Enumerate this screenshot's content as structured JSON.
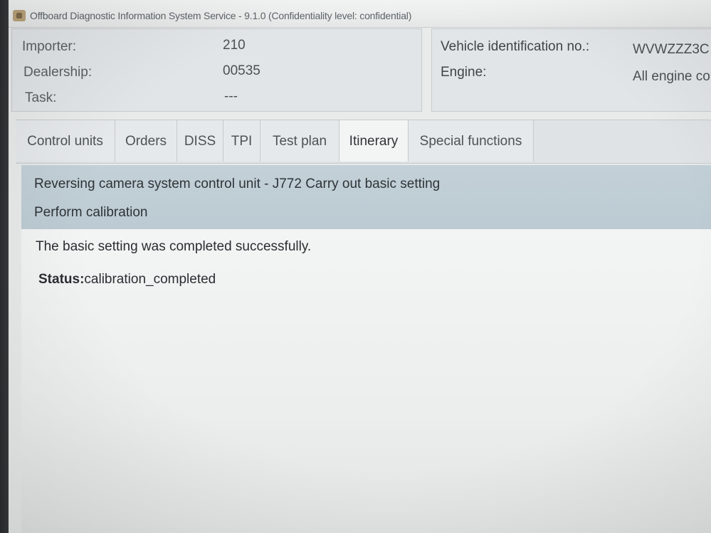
{
  "window": {
    "title": "Offboard Diagnostic Information System Service - 9.1.0 (Confidentiality level: confidential)"
  },
  "header": {
    "importer_label": "Importer:",
    "importer_value": "210",
    "dealership_label": "Dealership:",
    "dealership_value": "00535",
    "task_label": "Task:",
    "task_value": "---",
    "vin_label": "Vehicle identification no.:",
    "vin_value": "WVWZZZ3C",
    "engine_label": "Engine:",
    "engine_value": "All engine co"
  },
  "tabs": [
    {
      "label": "Control units"
    },
    {
      "label": "Orders"
    },
    {
      "label": "DISS"
    },
    {
      "label": "TPI"
    },
    {
      "label": "Test plan"
    },
    {
      "label": "Itinerary",
      "active": true
    },
    {
      "label": "Special functions"
    }
  ],
  "banner": {
    "title": "Reversing camera system control unit - J772 Carry out basic setting",
    "subtitle": "Perform calibration"
  },
  "content": {
    "message": "The basic setting was completed successfully.",
    "status_label": "Status:",
    "status_value": "calibration_completed"
  }
}
